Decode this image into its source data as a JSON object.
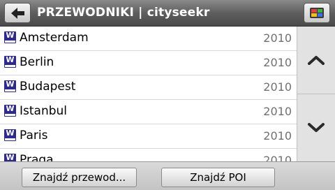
{
  "header": {
    "title": "PRZEWODNIKI | cityseekr"
  },
  "guides": [
    {
      "badge": "W",
      "name": "Amsterdam",
      "year": "2010"
    },
    {
      "badge": "W",
      "name": "Berlin",
      "year": "2010"
    },
    {
      "badge": "W",
      "name": "Budapest",
      "year": "2010"
    },
    {
      "badge": "W",
      "name": "Istanbul",
      "year": "2010"
    },
    {
      "badge": "W",
      "name": "Paris",
      "year": "2010"
    },
    {
      "badge": "W",
      "name": "Praga",
      "year": "2010"
    }
  ],
  "footer": {
    "find_guide_label": "Znajdź przewod...",
    "find_poi_label": "Znajdź POI"
  },
  "colors": {
    "header": "#5e5e5e",
    "badge": "#2e2a8c",
    "year_text": "#707070"
  },
  "icons": {
    "back": "back-arrow-icon",
    "map": "map-screen-icon",
    "scroll_up": "chevron-up-icon",
    "scroll_down": "chevron-down-icon"
  }
}
